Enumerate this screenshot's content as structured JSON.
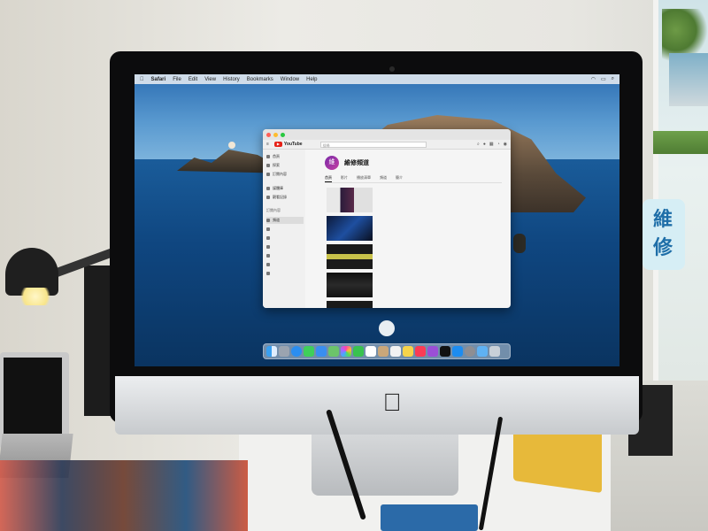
{
  "scene": {
    "wall_sign": "維修"
  },
  "menubar": {
    "apple": "",
    "app": "Safari",
    "menus": [
      "File",
      "Edit",
      "View",
      "History",
      "Bookmarks",
      "Window",
      "Help"
    ]
  },
  "browser": {
    "tab_title": "",
    "yt_mark": "▶",
    "yt_word": "YouTube",
    "search_placeholder": "搜尋",
    "sidebar": {
      "items": [
        "首頁",
        "探索",
        "訂閱內容",
        "媒體庫",
        "觀看記錄"
      ],
      "section": "訂閱內容",
      "active_label": "頻道"
    },
    "channel": {
      "avatar_text": "維",
      "name": "維修頻道",
      "tabs": [
        "首頁",
        "影片",
        "播放清單",
        "頻道",
        "簡介"
      ]
    },
    "videos": [
      {
        "title": "",
        "sub": ""
      },
      {
        "title": "",
        "sub": ""
      },
      {
        "title": "",
        "sub": ""
      },
      {
        "title": "",
        "sub": ""
      },
      {
        "title": "",
        "sub": ""
      }
    ]
  },
  "colors": {
    "youtube_red": "#e62117",
    "channel_avatar": "#7a2aa8",
    "dock": "#c8d7e6"
  },
  "icons": {
    "apple_logo": "apple-logo-icon",
    "dock": [
      "finder-icon",
      "launchpad-icon",
      "safari-icon",
      "messages-icon",
      "mail-icon",
      "maps-icon",
      "photos-icon",
      "facetime-icon",
      "calendar-icon",
      "contacts-icon",
      "reminders-icon",
      "notes-icon",
      "music-icon",
      "podcasts-icon",
      "tv-icon",
      "appstore-icon",
      "settings-icon",
      "folder-icon",
      "trash-icon"
    ]
  }
}
